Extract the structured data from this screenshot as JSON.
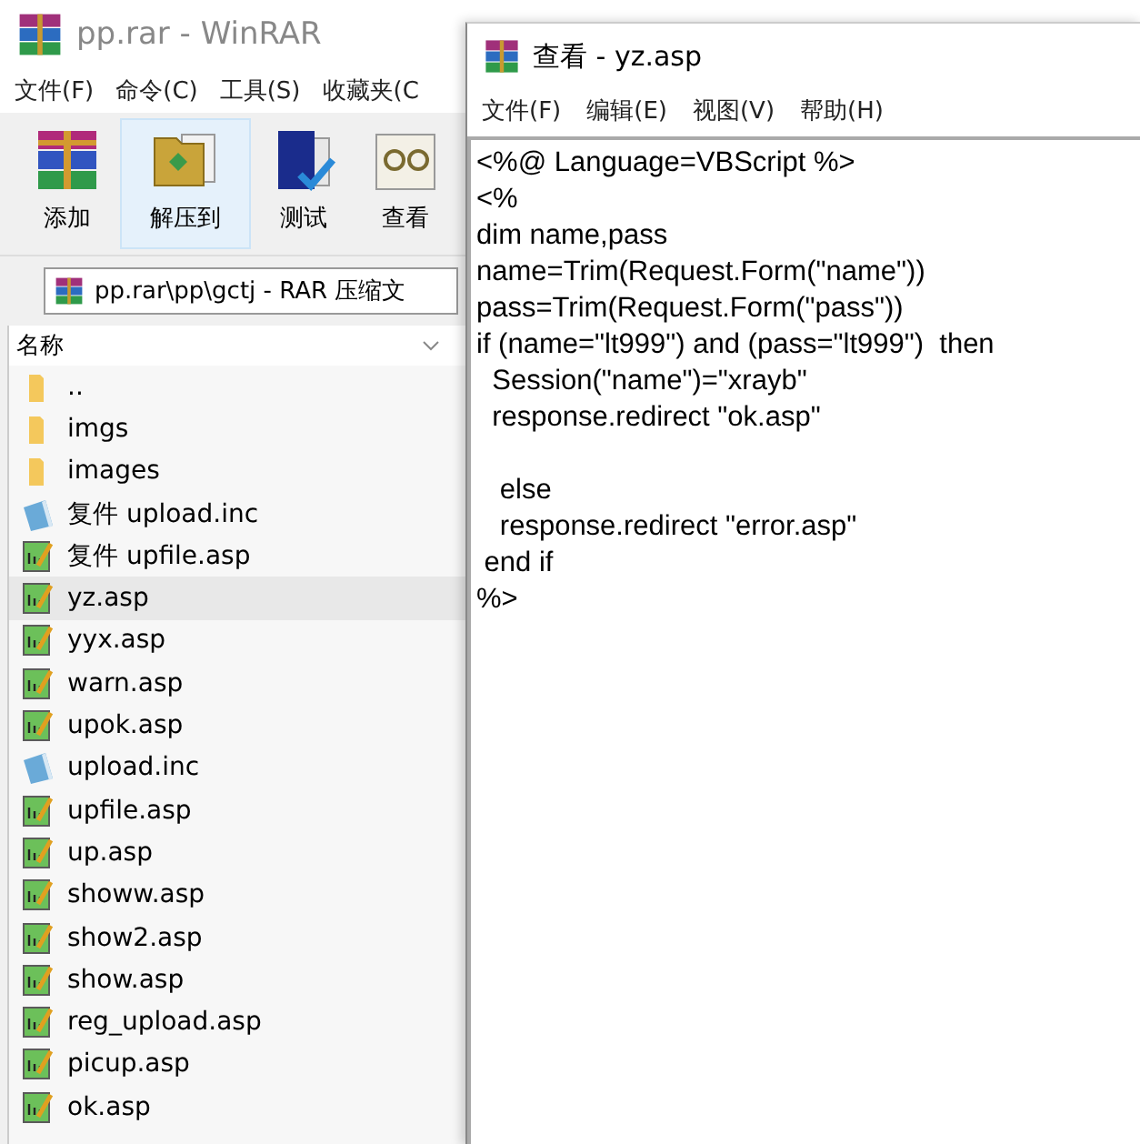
{
  "archive_window": {
    "title": "pp.rar - WinRAR",
    "menu": [
      "文件(F)",
      "命令(C)",
      "工具(S)",
      "收藏夹(C"
    ],
    "toolbar": [
      {
        "label": "添加",
        "kind": "add",
        "selected": false
      },
      {
        "label": "解压到",
        "kind": "extract",
        "selected": true
      },
      {
        "label": "测试",
        "kind": "test",
        "selected": false
      },
      {
        "label": "查看",
        "kind": "view",
        "selected": false
      }
    ],
    "path": "pp.rar\\pp\\gctj - RAR 压缩文",
    "column": "名称",
    "files": [
      {
        "name": "..",
        "kind": "folder",
        "selected": false
      },
      {
        "name": "imgs",
        "kind": "folder",
        "selected": false
      },
      {
        "name": "images",
        "kind": "folder",
        "selected": false
      },
      {
        "name": "复件 upload.inc",
        "kind": "inc",
        "selected": false
      },
      {
        "name": "复件 upfile.asp",
        "kind": "asp",
        "selected": false
      },
      {
        "name": "yz.asp",
        "kind": "asp",
        "selected": true
      },
      {
        "name": "yyx.asp",
        "kind": "asp",
        "selected": false
      },
      {
        "name": "warn.asp",
        "kind": "asp",
        "selected": false
      },
      {
        "name": "upok.asp",
        "kind": "asp",
        "selected": false
      },
      {
        "name": "upload.inc",
        "kind": "inc",
        "selected": false
      },
      {
        "name": "upfile.asp",
        "kind": "asp",
        "selected": false
      },
      {
        "name": "up.asp",
        "kind": "asp",
        "selected": false
      },
      {
        "name": "showw.asp",
        "kind": "asp",
        "selected": false
      },
      {
        "name": "show2.asp",
        "kind": "asp",
        "selected": false
      },
      {
        "name": "show.asp",
        "kind": "asp",
        "selected": false
      },
      {
        "name": "reg_upload.asp",
        "kind": "asp",
        "selected": false
      },
      {
        "name": "picup.asp",
        "kind": "asp",
        "selected": false
      },
      {
        "name": "ok.asp",
        "kind": "asp",
        "selected": false
      }
    ]
  },
  "viewer_window": {
    "title": "查看 - yz.asp",
    "menu": [
      "文件(F)",
      "编辑(E)",
      "视图(V)",
      "帮助(H)"
    ],
    "code_blocks": [
      [
        "<%@ Language=VBScript %>",
        "<%",
        "dim name,pass",
        "name=Trim(Request.Form(\"name\"))",
        "pass=Trim(Request.Form(\"pass\"))",
        "if (name=\"lt999\") and (pass=\"lt999\")  then",
        "  Session(\"name\")=\"xrayb\"",
        "  response.redirect \"ok.asp\""
      ],
      [
        "   else",
        "   response.redirect \"error.asp\"",
        " end if",
        "%>"
      ]
    ]
  }
}
